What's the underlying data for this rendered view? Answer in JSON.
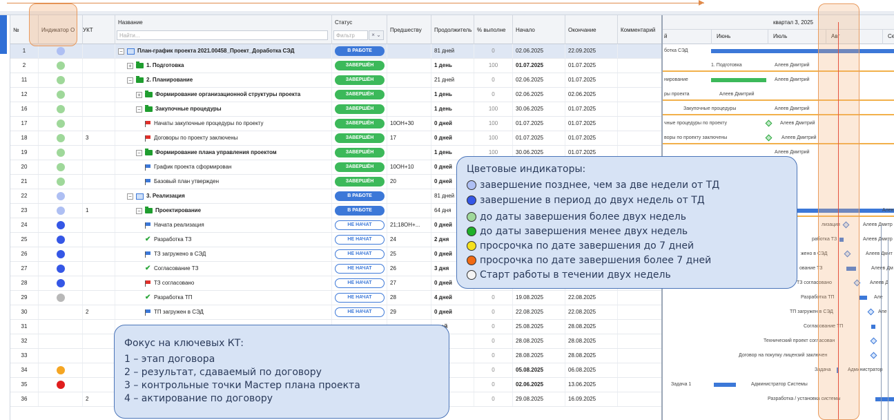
{
  "columns": {
    "no": "№",
    "indicator": "Индикатор О",
    "ukt": "УКТ",
    "name": "Название",
    "name_placeholder": "Найти...",
    "status": "Статус",
    "status_placeholder": "Фильтр",
    "status_select": "× ⌄",
    "pred": "Предшеству",
    "duration": "Продолжитель",
    "pct": "% выполне",
    "start": "Начало",
    "end": "Окончание",
    "comment": "Комментарий"
  },
  "status_labels": {
    "done": "ЗАВЕРШЁН",
    "work": "В РАБОТЕ",
    "new": "НЕ НАЧАТ"
  },
  "indicator_colors": {
    "light_green": "#9fd89a",
    "light_blue": "#aebff3",
    "blue": "#3557e6",
    "grey": "#b8b8b8",
    "orange": "#f5a623",
    "red": "#e01d1d",
    "green": "#1fb02a",
    "yellow": "#f5e11d",
    "dark_orange": "#f06a14",
    "white": "#f4f4f4"
  },
  "rows": [
    {
      "no": "1",
      "ind": "light_blue",
      "ukt": "",
      "name": "План-график проекта 2021.00458_Проект_Доработка СЭД",
      "status": "work",
      "pred": "",
      "dur": "81 дней",
      "pct": "0",
      "start": "02.06.2025",
      "end": "22.09.2025"
    },
    {
      "no": "2",
      "ind": "light_green",
      "ukt": "",
      "name": "1. Подготовка",
      "status": "done",
      "pred": "",
      "dur": "1 день",
      "pct": "100",
      "start": "01.07.2025",
      "end": "01.07.2025"
    },
    {
      "no": "11",
      "ind": "light_green",
      "ukt": "",
      "name": "2. Планирование",
      "status": "done",
      "pred": "",
      "dur": "21 дней",
      "pct": "0",
      "start": "02.06.2025",
      "end": "01.07.2025"
    },
    {
      "no": "12",
      "ind": "light_green",
      "ukt": "",
      "name": "Формирование организационной структуры проекта",
      "status": "done",
      "pred": "",
      "dur": "1 день",
      "pct": "0",
      "start": "02.06.2025",
      "end": "02.06.2025"
    },
    {
      "no": "16",
      "ind": "light_green",
      "ukt": "",
      "name": "Закупочные процедуры",
      "status": "done",
      "pred": "",
      "dur": "1 день",
      "pct": "100",
      "start": "30.06.2025",
      "end": "01.07.2025"
    },
    {
      "no": "17",
      "ind": "light_green",
      "ukt": "",
      "name": "Начаты закупочные процедуры по проекту",
      "status": "done",
      "pred": "10ОН+30",
      "dur": "0 дней",
      "pct": "100",
      "start": "01.07.2025",
      "end": "01.07.2025"
    },
    {
      "no": "18",
      "ind": "light_green",
      "ukt": "3",
      "name": "Договоры по проекту заключены",
      "status": "done",
      "pred": "17",
      "dur": "0 дней",
      "pct": "100",
      "start": "01.07.2025",
      "end": "01.07.2025"
    },
    {
      "no": "19",
      "ind": "light_green",
      "ukt": "",
      "name": "Формирование плана управления проектом",
      "status": "done",
      "pred": "",
      "dur": "1 день",
      "pct": "100",
      "start": "30.06.2025",
      "end": "01.07.2025"
    },
    {
      "no": "20",
      "ind": "light_green",
      "ukt": "",
      "name": "График проекта сформирован",
      "status": "done",
      "pred": "10ОН+10",
      "dur": "0 дней",
      "pct": "",
      "start": "",
      "end": ""
    },
    {
      "no": "21",
      "ind": "light_green",
      "ukt": "",
      "name": "Базовый план утвержден",
      "status": "done",
      "pred": "20",
      "dur": "0 дней",
      "pct": "",
      "start": "",
      "end": ""
    },
    {
      "no": "22",
      "ind": "light_blue",
      "ukt": "",
      "name": "3. Реализация",
      "status": "work",
      "pred": "",
      "dur": "81 дней",
      "pct": "",
      "start": "",
      "end": ""
    },
    {
      "no": "23",
      "ind": "light_blue",
      "ukt": "1",
      "name": "Проектирование",
      "status": "work",
      "pred": "",
      "dur": "64 дня",
      "pct": "",
      "start": "",
      "end": ""
    },
    {
      "no": "24",
      "ind": "blue",
      "ukt": "",
      "name": "Начата реализация",
      "status": "new",
      "pred": "21;18ОН+...",
      "dur": "0 дней",
      "pct": "",
      "start": "",
      "end": ""
    },
    {
      "no": "25",
      "ind": "blue",
      "ukt": "",
      "name": "Разработка ТЗ",
      "status": "new",
      "pred": "24",
      "dur": "2 дня",
      "pct": "",
      "start": "",
      "end": ""
    },
    {
      "no": "26",
      "ind": "blue",
      "ukt": "",
      "name": "ТЗ загружено в СЭД",
      "status": "new",
      "pred": "25",
      "dur": "0 дней",
      "pct": "",
      "start": "",
      "end": ""
    },
    {
      "no": "27",
      "ind": "blue",
      "ukt": "",
      "name": "Согласование ТЗ",
      "status": "new",
      "pred": "26",
      "dur": "3 дня",
      "pct": "",
      "start": "",
      "end": ""
    },
    {
      "no": "28",
      "ind": "blue",
      "ukt": "",
      "name": "ТЗ согласовано",
      "status": "new",
      "pred": "27",
      "dur": "0 дней",
      "pct": "",
      "start": "",
      "end": ""
    },
    {
      "no": "29",
      "ind": "grey",
      "ukt": "",
      "name": "Разработка ТП",
      "status": "new",
      "pred": "28",
      "dur": "4 дней",
      "pct": "0",
      "start": "19.08.2025",
      "end": "22.08.2025"
    },
    {
      "no": "30",
      "ind": "",
      "ukt": "2",
      "name": "ТП загружен в СЭД",
      "status": "new",
      "pred": "29",
      "dur": "0 дней",
      "pct": "0",
      "start": "22.08.2025",
      "end": "22.08.2025"
    },
    {
      "no": "31",
      "ind": "",
      "ukt": "",
      "name": "",
      "status": "",
      "pred": "",
      "dur": "дней",
      "pct": "0",
      "start": "25.08.2025",
      "end": "28.08.2025"
    },
    {
      "no": "32",
      "ind": "",
      "ukt": "",
      "name": "",
      "status": "",
      "pred": "",
      "dur": "ней",
      "pct": "0",
      "start": "28.08.2025",
      "end": "28.08.2025"
    },
    {
      "no": "33",
      "ind": "",
      "ukt": "",
      "name": "",
      "status": "",
      "pred": "",
      "dur": "ней",
      "pct": "0",
      "start": "28.08.2025",
      "end": "28.08.2025"
    },
    {
      "no": "34",
      "ind": "orange",
      "ukt": "",
      "name": "",
      "status": "",
      "pred": "",
      "dur": "ень",
      "pct": "0",
      "start": "05.08.2025",
      "end": "06.08.2025"
    },
    {
      "no": "35",
      "ind": "red",
      "ukt": "",
      "name": "",
      "status": "",
      "pred": "",
      "dur": "дней",
      "pct": "0",
      "start": "02.06.2025",
      "end": "13.06.2025"
    },
    {
      "no": "36",
      "ind": "",
      "ukt": "2",
      "name": "",
      "status": "",
      "pred": "",
      "dur": "ней",
      "pct": "0",
      "start": "29.08.2025",
      "end": "16.09.2025"
    }
  ],
  "gantt": {
    "quarter": "квартал 3, 2025",
    "months": [
      "й",
      "Июнь",
      "Июль",
      "Авг",
      "Се"
    ],
    "labels": [
      "ботка СЭД",
      "1. Подготовка",
      "Алеев Дмитрий",
      "нирование",
      "Алеев Дмитрий",
      "ры проекта",
      "Алеев Дмитрий",
      "Закупочные процедуры",
      "Алеев Дмитрий",
      "чные процедуры по проекту",
      "Алеев Дмитрий",
      "воры по проекту заключены",
      "Алеев Дмитрий",
      "Алеев Дмитрий",
      "Ален",
      "лизация",
      "Алеев Дмитр",
      "работка ТЗ",
      "Алеев Дмитр",
      "жено в СЭД",
      "Алеев Дмит",
      "ование ТЗ",
      "Алеев Дм",
      "ТЗ согласовано",
      "Алеев Д",
      "Разработка ТП",
      "Але",
      "ТП загружен в СЭД",
      "Але",
      "Согласование ТП",
      "Технический проект согласован",
      "Договор на покупку лицензий заключен",
      "Задача",
      "Администратор",
      "Задача 1",
      "Администратор Системы",
      "Разработка / установка системы"
    ]
  },
  "legend": {
    "title": "Цветовые индикаторы:",
    "items": [
      {
        "color": "light_blue",
        "text": "завершение позднее, чем за две недели от ТД"
      },
      {
        "color": "blue",
        "text": "завершение в период до двух недель от ТД"
      },
      {
        "color": "light_green",
        "text": "до даты завершения более двух недель"
      },
      {
        "color": "green",
        "text": "до даты завершения менее двух недель"
      },
      {
        "color": "yellow",
        "text": "просрочка по дате завершения до 7 дней"
      },
      {
        "color": "dark_orange",
        "text": "просрочка по дате завершения более 7 дней"
      },
      {
        "color": "white",
        "text": "Старт работы в течении двух недель"
      }
    ]
  },
  "focus": {
    "title": "Фокус на ключевых КТ:",
    "lines": [
      "1 – этап договора",
      "2 – результат, сдаваемый по договору",
      "3 – контрольные точки Мастер плана проекта",
      "4 – актирование по договору"
    ]
  }
}
